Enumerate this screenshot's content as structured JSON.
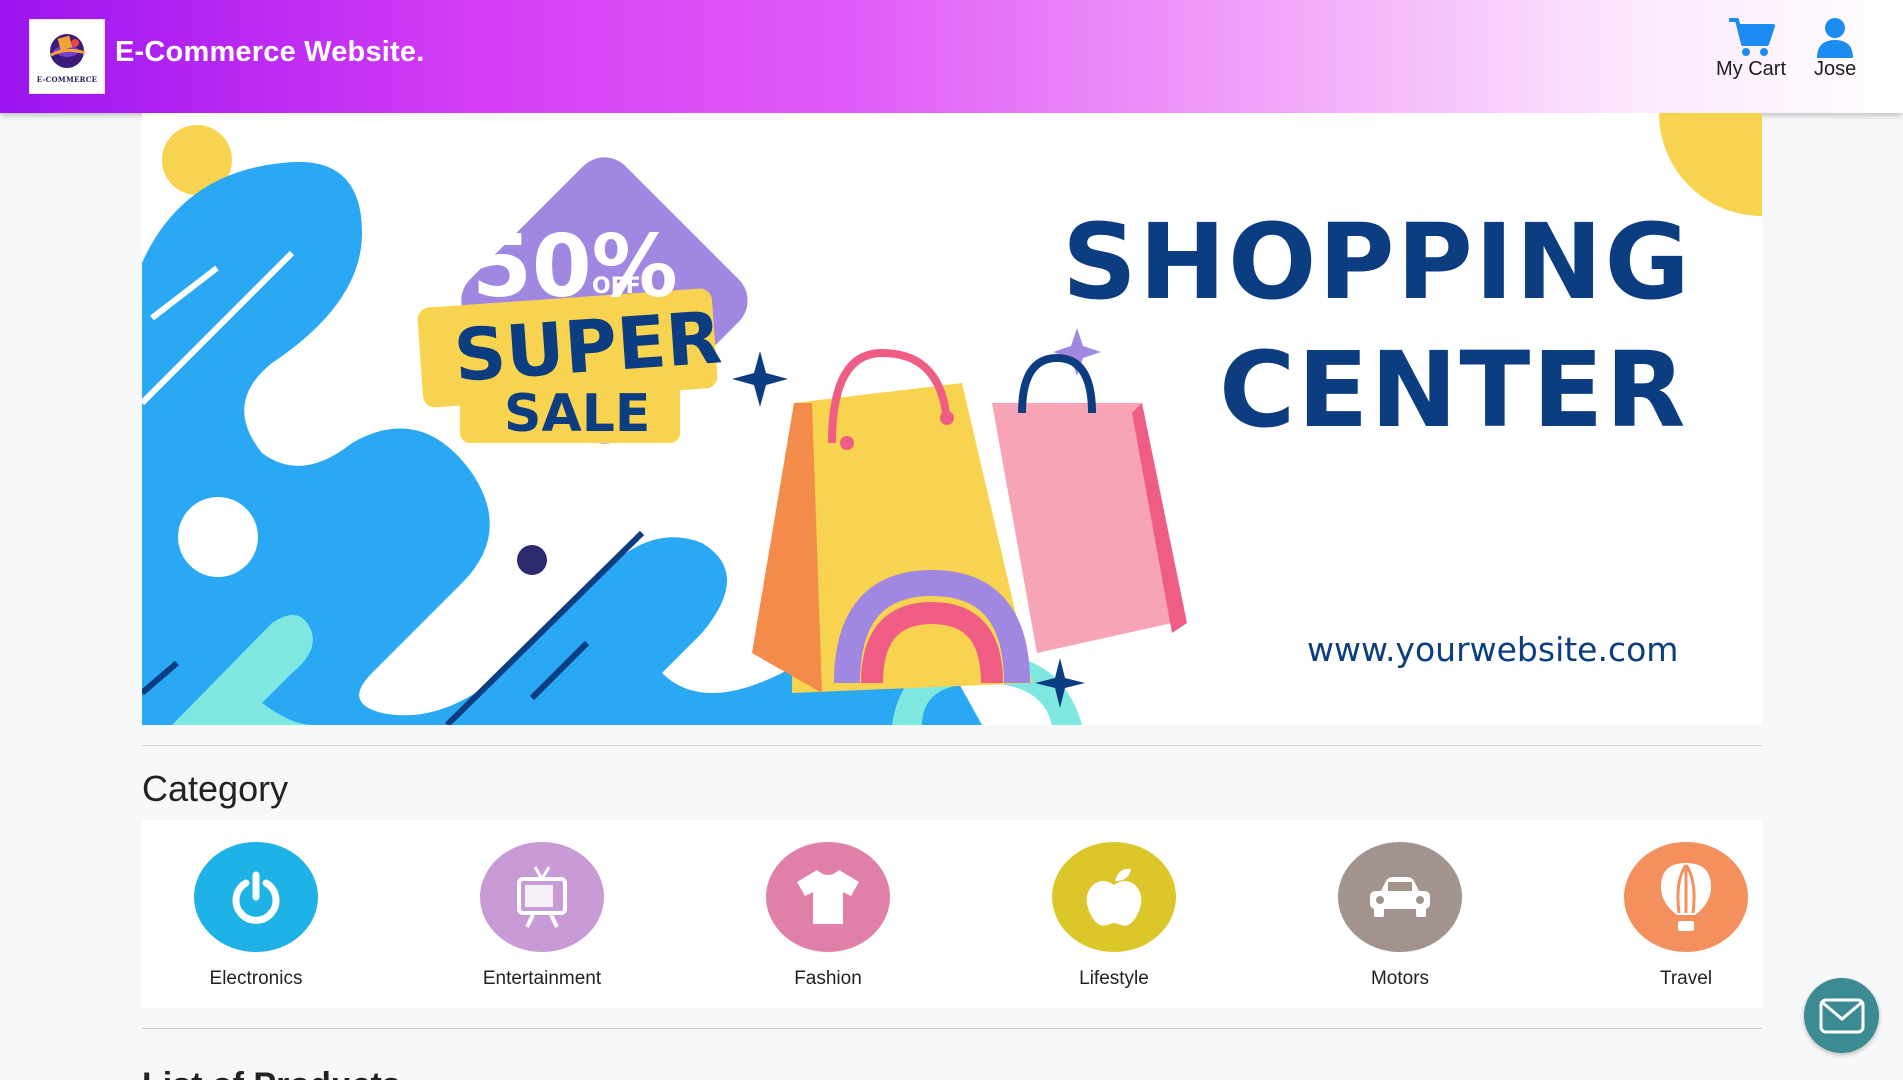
{
  "header": {
    "logo_text": "E-COMMERCE",
    "site_title": "E-Commerce Website.",
    "cart_label": "My Cart",
    "user_label": "Jose",
    "gradient_colors": [
      "#9b14f0",
      "#d53df5",
      "#f2a9f9",
      "#ffffff"
    ]
  },
  "banner": {
    "discount": "50%",
    "off": "OFF",
    "super": "SUPER",
    "sale": "SALE",
    "headline_line1": "SHOPPING",
    "headline_line2": "CENTER",
    "url": "www.yourwebsite.com",
    "prev_icon": "chevron-left-icon",
    "next_icon": "chevron-right-icon"
  },
  "category": {
    "title": "Category",
    "items": [
      {
        "label": "Electronics",
        "icon": "power-icon",
        "color": "#1fb2e6"
      },
      {
        "label": "Entertainment",
        "icon": "tv-icon",
        "color": "#c89ad6"
      },
      {
        "label": "Fashion",
        "icon": "tshirt-icon",
        "color": "#e07fa8"
      },
      {
        "label": "Lifestyle",
        "icon": "apple-icon",
        "color": "#dcc72a"
      },
      {
        "label": "Motors",
        "icon": "car-icon",
        "color": "#a3938f"
      },
      {
        "label": "Travel",
        "icon": "hot-air-balloon-icon",
        "color": "#f4905e"
      }
    ]
  },
  "next_section": {
    "title": "List of Products"
  },
  "fab": {
    "icon": "envelope-icon"
  }
}
